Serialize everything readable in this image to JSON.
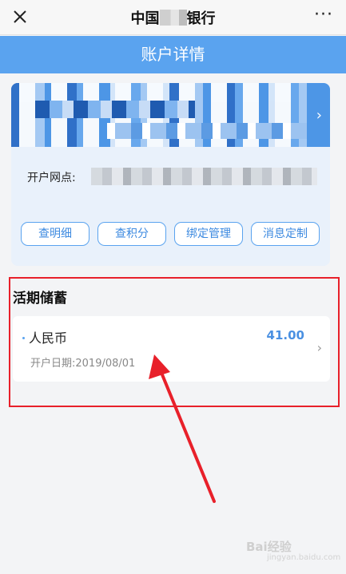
{
  "top_bar": {
    "title_left": "中国",
    "title_right": "银行",
    "more_label": "···"
  },
  "header": {
    "title": "账户详情"
  },
  "account": {
    "branch_label": "开户网点:",
    "buttons": [
      {
        "label": "查明细"
      },
      {
        "label": "查积分"
      },
      {
        "label": "绑定管理"
      },
      {
        "label": "消息定制"
      }
    ]
  },
  "savings": {
    "section_title": "活期储蓄",
    "currency": "人民币",
    "amount": "41.00",
    "open_date": "开户日期:2019/08/01"
  },
  "watermark": {
    "text": "Bai经验",
    "sub": "jingyan.baidu.com"
  },
  "colors": {
    "accent": "#5aa3ef",
    "amount": "#4a90e2",
    "annotation_red": "#e8202a"
  }
}
